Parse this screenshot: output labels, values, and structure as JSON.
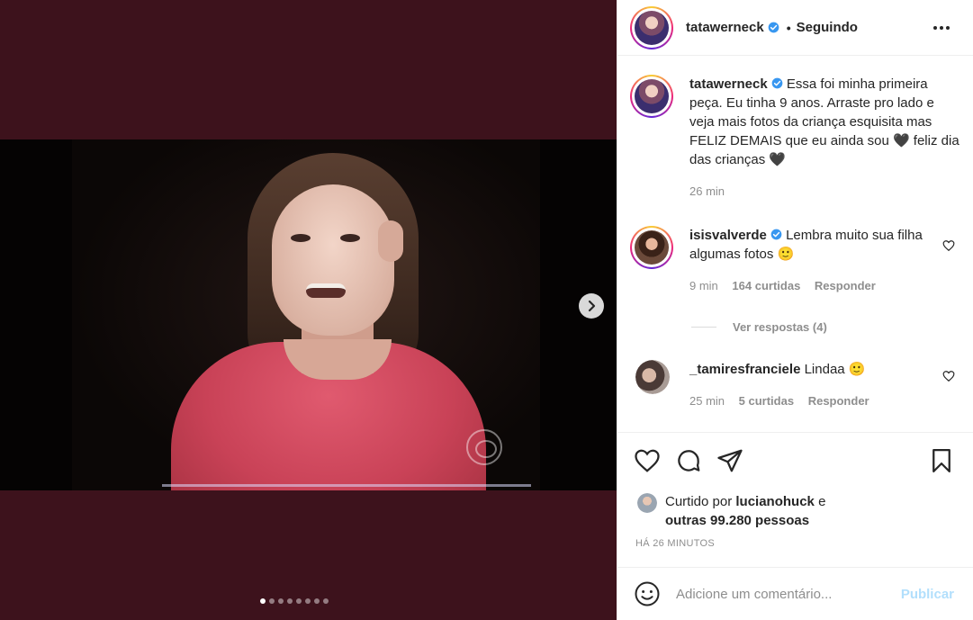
{
  "post": {
    "username": "tatawerneck",
    "follow_status": "Seguindo",
    "caption": "Essa foi minha primeira peça. Eu tinha 9 anos. Arraste pro lado e veja mais fotos da criança esquisita mas FELIZ DEMAIS que eu ainda sou 🖤 feliz dia das crianças 🖤",
    "caption_time": "26 min",
    "carousel": {
      "total": 8,
      "active": 1
    }
  },
  "comments": [
    {
      "username": "isisvalverde",
      "verified": true,
      "text": "Lembra muito sua filha algumas fotos 🙂",
      "time": "9 min",
      "likes": "164 curtidas",
      "reply": "Responder"
    },
    {
      "username": "_tamiresfranciele",
      "verified": false,
      "text": "Lindaa 🙂",
      "time": "25 min",
      "likes": "5 curtidas",
      "reply": "Responder"
    }
  ],
  "view_replies": "Ver respostas (4)",
  "likes": {
    "prefix": "Curtido por",
    "user": "lucianohuck",
    "connector": "e",
    "others": "outras 99.280 pessoas"
  },
  "time_ago": "HÁ 26 MINUTOS",
  "add_comment": {
    "placeholder": "Adicione um comentário...",
    "publish": "Publicar"
  },
  "colors": {
    "media_bg": "#3d121c",
    "verified": "#3897f0",
    "publish": "#b2dffc"
  },
  "icons": [
    "next-arrow-icon",
    "verified-icon",
    "more-icon",
    "heart-icon",
    "comment-icon",
    "share-icon",
    "bookmark-icon",
    "emoji-icon"
  ]
}
